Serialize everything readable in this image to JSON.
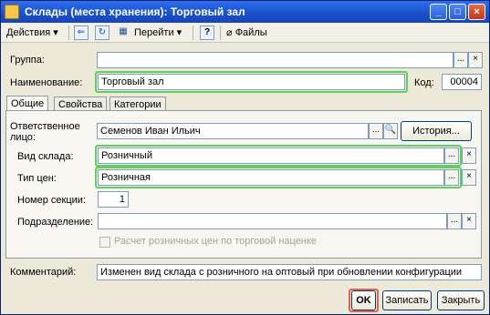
{
  "window": {
    "title": "Склады (места хранения): Торговый зал",
    "minimize_glyph": "_",
    "maximize_glyph": "□",
    "close_glyph": "×"
  },
  "toolbar": {
    "actions_label": "Действия",
    "goto_label": "Перейти",
    "help_glyph": "?",
    "files_label": "Файлы",
    "dropdown_glyph": "▾"
  },
  "form": {
    "group_label": "Группа:",
    "group_value": "",
    "name_label": "Наименование:",
    "name_value": "Торговый зал",
    "code_label": "Код:",
    "code_value": "00004"
  },
  "tabs": [
    "Общие",
    "Свойства",
    "Категории"
  ],
  "general": {
    "responsible_label_line1": "Ответственное",
    "responsible_label_line2": "лицо:",
    "responsible_value": "Семенов Иван Ильич",
    "history_button": "История...",
    "warehouse_type_label": "Вид склада:",
    "warehouse_type_value": "Розничный",
    "price_type_label": "Тип цен:",
    "price_type_value": "Розничная",
    "section_label": "Номер секции:",
    "section_value": "1",
    "department_label": "Подразделение:",
    "department_value": "",
    "retail_checkbox_label": "Расчет розничных цен по торговой наценке",
    "retail_checkbox_checked": false
  },
  "comment": {
    "label": "Комментарий:",
    "value": "Изменен вид склада с розничного на оптовый при обновлении конфигурации"
  },
  "buttons": {
    "ok": "OK",
    "save": "Записать",
    "close": "Закрыть"
  },
  "glyphs": {
    "select": "...",
    "clear": "×",
    "search": "🔍"
  },
  "colors": {
    "highlight_green": "#5fd05f",
    "highlight_red": "#e8604a",
    "titlebar_blue": "#1a4fc8"
  }
}
